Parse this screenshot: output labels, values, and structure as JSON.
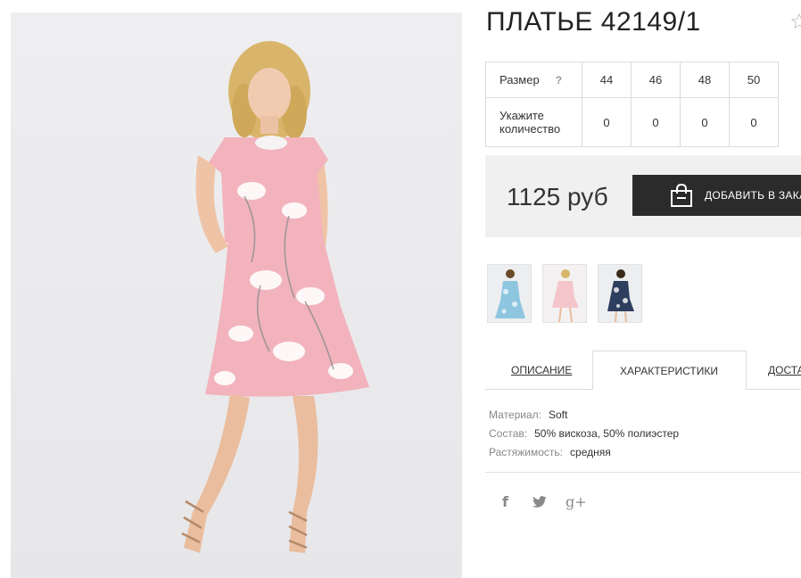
{
  "product": {
    "title": "ПЛАТЬЕ 42149/1"
  },
  "sizes": {
    "size_label": "Размер",
    "help": "?",
    "qty_label": "Укажите количество",
    "columns": [
      "44",
      "46",
      "48",
      "50"
    ],
    "quantities": [
      "0",
      "0",
      "0",
      "0"
    ]
  },
  "price": {
    "amount": "1125 руб"
  },
  "cart": {
    "add_label": "ДОБАВИТЬ В ЗАКАЗ"
  },
  "tabs": [
    {
      "label": "ОПИСАНИЕ"
    },
    {
      "label": "ХАРАКТЕРИСТИКИ"
    },
    {
      "label": "ДОСТАВКА"
    }
  ],
  "specs": [
    {
      "key": "Материал:",
      "value": "Soft"
    },
    {
      "key": "Состав:",
      "value": "50% вискоза, 50% полиэстер"
    },
    {
      "key": "Растяжимость:",
      "value": "средняя"
    }
  ],
  "social": {
    "facebook": "f",
    "twitter": "twitter-icon",
    "google": "g+"
  },
  "colors": {
    "accent_dark": "#2b2b2b",
    "price_bg": "#f0f0f0",
    "dress_pink": "#f2b3bd"
  }
}
